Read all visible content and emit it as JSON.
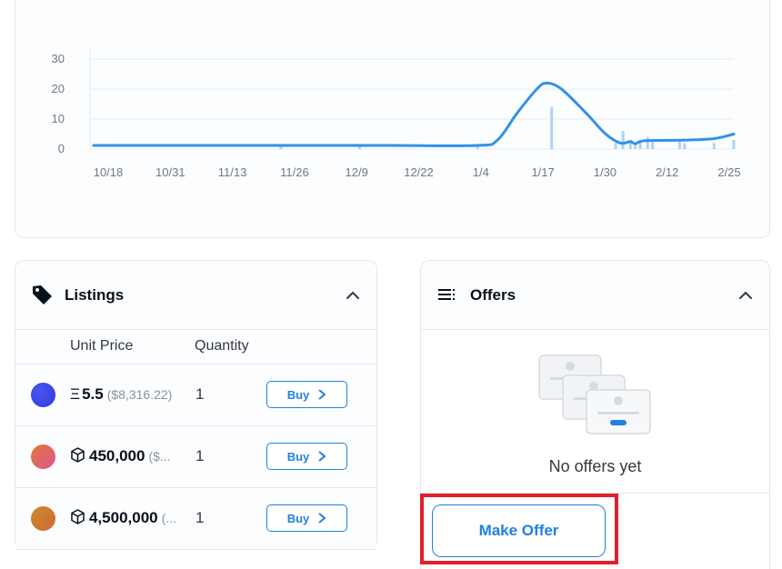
{
  "chart_data": {
    "type": "line",
    "y_ticks": [
      "30",
      "20",
      "10",
      "0"
    ],
    "ylim": [
      0,
      32
    ],
    "x_ticks": [
      "10/18",
      "10/31",
      "11/13",
      "11/26",
      "12/9",
      "12/22",
      "1/4",
      "1/17",
      "1/30",
      "2/12",
      "2/25"
    ],
    "grid": true,
    "line": [
      {
        "x": 0,
        "y": 1.2
      },
      {
        "x": 40,
        "y": 1.2
      },
      {
        "x": 60,
        "y": 1.2
      },
      {
        "x": 78,
        "y": 1.2
      },
      {
        "x": 82,
        "y": 3
      },
      {
        "x": 86,
        "y": 12
      },
      {
        "x": 90,
        "y": 20
      },
      {
        "x": 92,
        "y": 22
      },
      {
        "x": 95,
        "y": 20
      },
      {
        "x": 100,
        "y": 12
      },
      {
        "x": 104,
        "y": 5
      },
      {
        "x": 107,
        "y": 2
      },
      {
        "x": 109,
        "y": 2.5
      },
      {
        "x": 110,
        "y": 1.8
      },
      {
        "x": 112,
        "y": 2.8
      },
      {
        "x": 120,
        "y": 3
      },
      {
        "x": 126,
        "y": 3.5
      },
      {
        "x": 130,
        "y": 5
      }
    ],
    "bars": [
      {
        "x": 38,
        "y": 1
      },
      {
        "x": 54,
        "y": 0.8
      },
      {
        "x": 78,
        "y": 1
      },
      {
        "x": 93,
        "y": 14
      },
      {
        "x": 106,
        "y": 2
      },
      {
        "x": 107.5,
        "y": 6
      },
      {
        "x": 109,
        "y": 3
      },
      {
        "x": 110,
        "y": 1.5
      },
      {
        "x": 111,
        "y": 3
      },
      {
        "x": 112.5,
        "y": 4
      },
      {
        "x": 113.5,
        "y": 3
      },
      {
        "x": 119,
        "y": 3
      },
      {
        "x": 120,
        "y": 2
      },
      {
        "x": 126,
        "y": 2
      },
      {
        "x": 130,
        "y": 3
      }
    ],
    "x_range": [
      0,
      130
    ]
  },
  "listings": {
    "title": "Listings",
    "col_price": "Unit Price",
    "col_qty": "Quantity",
    "rows": [
      {
        "symbol": "Ξ",
        "price": "5.5",
        "usd": "($8,316.22)",
        "qty": "1",
        "buy": "Buy",
        "color_a": "#2d3adf",
        "color_b": "#4a55f0"
      },
      {
        "symbol": "cube",
        "price": "450,000",
        "usd": "($...",
        "qty": "1",
        "buy": "Buy",
        "color_a": "#e5763a",
        "color_b": "#d9578b"
      },
      {
        "symbol": "cube",
        "price": "4,500,000",
        "usd": "(...",
        "qty": "1",
        "buy": "Buy",
        "color_a": "#c88a2a",
        "color_b": "#d06a34"
      }
    ]
  },
  "offers": {
    "title": "Offers",
    "empty_text": "No offers yet",
    "make_offer": "Make Offer"
  },
  "colors": {
    "accent": "#2081e2",
    "line": "#3291e9",
    "bar": "#aed3f4",
    "highlight": "#e0202a"
  }
}
